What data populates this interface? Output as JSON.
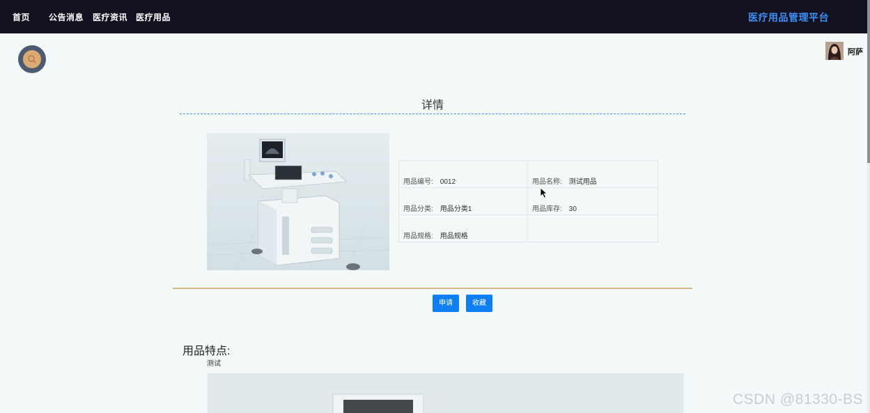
{
  "nav": {
    "items": [
      {
        "label": "首页"
      },
      {
        "label": "公告消息"
      },
      {
        "label": "医疗资讯"
      },
      {
        "label": "医疗用品"
      }
    ],
    "brand": "医疗用品管理平台"
  },
  "user": {
    "name": "阿萨"
  },
  "detail": {
    "title": "详情",
    "fields": [
      {
        "label": "用品编号:",
        "value": "0012"
      },
      {
        "label": "用品名称:",
        "value": "测试用品"
      },
      {
        "label": "用品分类:",
        "value": "用品分类1"
      },
      {
        "label": "用品库存:",
        "value": "30"
      },
      {
        "label": "用品规格:",
        "value": "用品规格"
      }
    ]
  },
  "actions": {
    "apply_label": "申请",
    "favorite_label": "收藏"
  },
  "features": {
    "title": "用品特点:",
    "text": "测试"
  },
  "watermark": "CSDN @81330-BS",
  "colors": {
    "topbar": "#11111f",
    "brand": "#3d8ff5",
    "button": "#0d7ff0",
    "divider": "#d9b583",
    "search_button": "#4e5a70",
    "search_inner": "#dcab73"
  }
}
